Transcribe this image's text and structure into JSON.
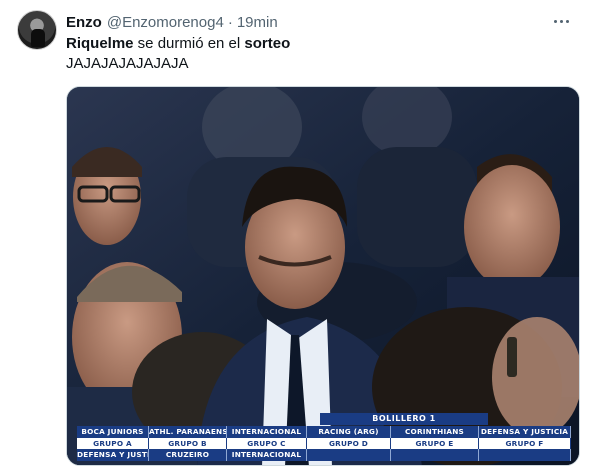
{
  "tweet": {
    "author_name": "Enzo",
    "handle": "@Enzomorenog4",
    "separator": "·",
    "time": "19min",
    "text_line1": {
      "part1": "Riquelme",
      "part2": " se durmió en el ",
      "part3": "sorteo"
    },
    "text_line2": "JAJAJAJAJAJAJA",
    "more_icon": "more-horizontal-icon"
  },
  "broadcast": {
    "bolillero_label": "BOLILLERO 1",
    "teams": [
      "BOCA JUNIORS",
      "ATHL. PARANAENSE",
      "INTERNACIONAL",
      "RACING (ARG)",
      "CORINTHIANS",
      "DEFENSA Y JUSTICIA"
    ],
    "groups": [
      "GRUPO A",
      "GRUPO B",
      "GRUPO C",
      "GRUPO D",
      "GRUPO E",
      "GRUPO F"
    ],
    "group_draws": [
      "DEFENSA Y JUSTICIA",
      "CRUZEIRO",
      "INTERNACIONAL",
      "",
      "",
      ""
    ]
  },
  "colors": {
    "text_primary": "#0f1419",
    "text_secondary": "#536471",
    "broadcast_blue": "#1a3c84"
  }
}
